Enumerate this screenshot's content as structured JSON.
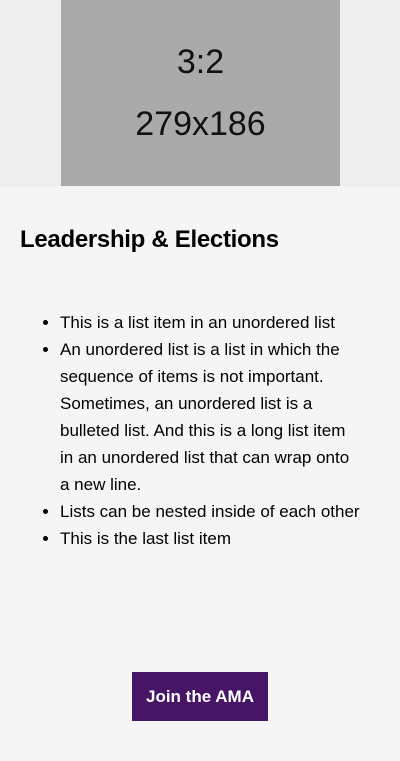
{
  "placeholder": {
    "ratio": "3:2",
    "size": "279x186"
  },
  "section": {
    "title": "Leadership & Elections",
    "list": [
      "This is a list item in an unordered list",
      "An unordered list is a list in which the sequence of items is not important. Sometimes, an unordered list is a bulleted list. And this is a long list item in an unordered list that can wrap onto a new line.",
      "Lists can be nested inside of each other",
      "This is the last list item"
    ],
    "button_label": "Join the AMA"
  },
  "colors": {
    "button": "#461566",
    "placeholder": "#aaaaaa",
    "background": "#f5f5f5"
  }
}
